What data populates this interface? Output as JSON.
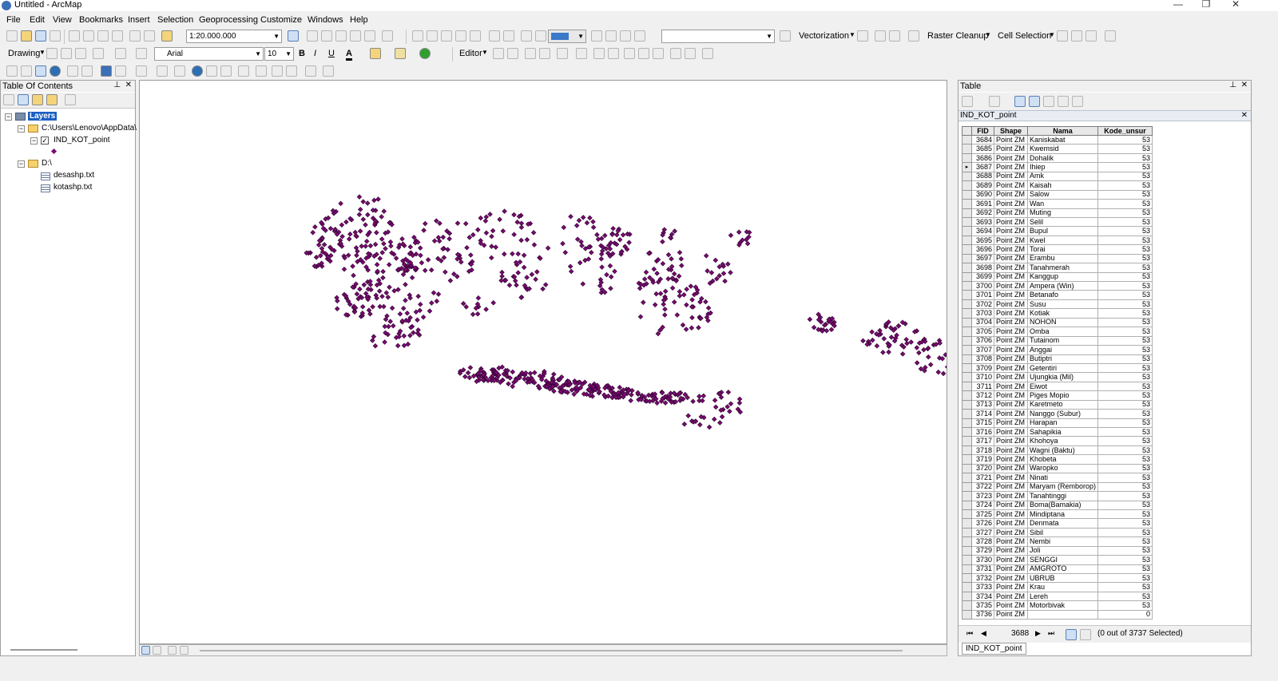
{
  "window": {
    "title": "Untitled - ArcMap"
  },
  "menu": [
    "File",
    "Edit",
    "View",
    "Bookmarks",
    "Insert",
    "Selection",
    "Geoprocessing",
    "Customize",
    "Windows",
    "Help"
  ],
  "toolbar": {
    "scale": "1:20.000.000",
    "vectorization_label": "Vectorization",
    "raster_cleanup_label": "Raster Cleanup",
    "cell_selection_label": "Cell Selection",
    "drawing_label": "Drawing",
    "font_name": "Arial",
    "font_size": "10",
    "bold": "B",
    "italic": "I",
    "underline": "U",
    "editor_label": "Editor"
  },
  "toc": {
    "title": "Table Of Contents",
    "root": "Layers",
    "folder1": "C:\\Users\\Lenovo\\AppData\\",
    "layer1": "IND_KOT_point",
    "folder2": "D:\\",
    "table1": "desashp.txt",
    "table2": "kotashp.txt"
  },
  "table_panel": {
    "title": "Table",
    "layer_tab": "IND_KOT_point",
    "bottom_tab": "IND_KOT_point",
    "current_record": "3688",
    "selection_status": "(0 out of 3737 Selected)",
    "columns": [
      "FID",
      "Shape",
      "Nama",
      "Kode_unsur"
    ],
    "rows": [
      [
        "3684",
        "Point ZM",
        "Kaniskabat",
        "53"
      ],
      [
        "3685",
        "Point ZM",
        "Kwemsid",
        "53"
      ],
      [
        "3686",
        "Point ZM",
        "Dohalik",
        "53"
      ],
      [
        "3687",
        "Point ZM",
        "Ihiep",
        "53"
      ],
      [
        "3688",
        "Point ZM",
        "Amk",
        "53"
      ],
      [
        "3689",
        "Point ZM",
        "Kaisah",
        "53"
      ],
      [
        "3690",
        "Point ZM",
        "Salow",
        "53"
      ],
      [
        "3691",
        "Point ZM",
        "Wan",
        "53"
      ],
      [
        "3692",
        "Point ZM",
        "Muting",
        "53"
      ],
      [
        "3693",
        "Point ZM",
        "Selil",
        "53"
      ],
      [
        "3694",
        "Point ZM",
        "Bupul",
        "53"
      ],
      [
        "3695",
        "Point ZM",
        "Kwel",
        "53"
      ],
      [
        "3696",
        "Point ZM",
        "Torai",
        "53"
      ],
      [
        "3697",
        "Point ZM",
        "Erambu",
        "53"
      ],
      [
        "3698",
        "Point ZM",
        "Tanahmerah",
        "53"
      ],
      [
        "3699",
        "Point ZM",
        "Kanggup",
        "53"
      ],
      [
        "3700",
        "Point ZM",
        "Ampera (Win)",
        "53"
      ],
      [
        "3701",
        "Point ZM",
        "Betanafo",
        "53"
      ],
      [
        "3702",
        "Point ZM",
        "Susu",
        "53"
      ],
      [
        "3703",
        "Point ZM",
        "Kotiak",
        "53"
      ],
      [
        "3704",
        "Point ZM",
        "NOHON",
        "53"
      ],
      [
        "3705",
        "Point ZM",
        "Omba",
        "53"
      ],
      [
        "3706",
        "Point ZM",
        "Tutainom",
        "53"
      ],
      [
        "3707",
        "Point ZM",
        "Anggai",
        "53"
      ],
      [
        "3708",
        "Point ZM",
        "Butiptri",
        "53"
      ],
      [
        "3709",
        "Point ZM",
        "Getentiri",
        "53"
      ],
      [
        "3710",
        "Point ZM",
        "Ujungkia (Mil)",
        "53"
      ],
      [
        "3711",
        "Point ZM",
        "Eiwot",
        "53"
      ],
      [
        "3712",
        "Point ZM",
        "Piges Mopio",
        "53"
      ],
      [
        "3713",
        "Point ZM",
        "Karetmeto",
        "53"
      ],
      [
        "3714",
        "Point ZM",
        "Nanggo (Subur)",
        "53"
      ],
      [
        "3715",
        "Point ZM",
        "Harapan",
        "53"
      ],
      [
        "3716",
        "Point ZM",
        "Sahapikia",
        "53"
      ],
      [
        "3717",
        "Point ZM",
        "Khohoya",
        "53"
      ],
      [
        "3718",
        "Point ZM",
        "Wagni (Baktu)",
        "53"
      ],
      [
        "3719",
        "Point ZM",
        "Khobeta",
        "53"
      ],
      [
        "3720",
        "Point ZM",
        "Waropko",
        "53"
      ],
      [
        "3721",
        "Point ZM",
        "Ninati",
        "53"
      ],
      [
        "3722",
        "Point ZM",
        "Maryam (Remborop)",
        "53"
      ],
      [
        "3723",
        "Point ZM",
        "Tanahtinggi",
        "53"
      ],
      [
        "3724",
        "Point ZM",
        "Boma(Bamakia)",
        "53"
      ],
      [
        "3725",
        "Point ZM",
        "Mindiptana",
        "53"
      ],
      [
        "3726",
        "Point ZM",
        "Denmata",
        "53"
      ],
      [
        "3727",
        "Point ZM",
        "Sibil",
        "53"
      ],
      [
        "3728",
        "Point ZM",
        "Nembi",
        "53"
      ],
      [
        "3729",
        "Point ZM",
        "Joli",
        "53"
      ],
      [
        "3730",
        "Point ZM",
        "SENGGI",
        "53"
      ],
      [
        "3731",
        "Point ZM",
        "AMGROTO",
        "53"
      ],
      [
        "3732",
        "Point ZM",
        "UBRUB",
        "53"
      ],
      [
        "3733",
        "Point ZM",
        "Krau",
        "53"
      ],
      [
        "3734",
        "Point ZM",
        "Lereh",
        "53"
      ],
      [
        "3735",
        "Point ZM",
        "Motorbivak",
        "53"
      ],
      [
        "3736",
        "Point ZM",
        "",
        "0"
      ]
    ],
    "current_row_index": 3
  },
  "colors": {
    "point_fill": "#7a0a73",
    "point_stroke": "#2a0028",
    "selection_blue": "#1b5fc2"
  }
}
